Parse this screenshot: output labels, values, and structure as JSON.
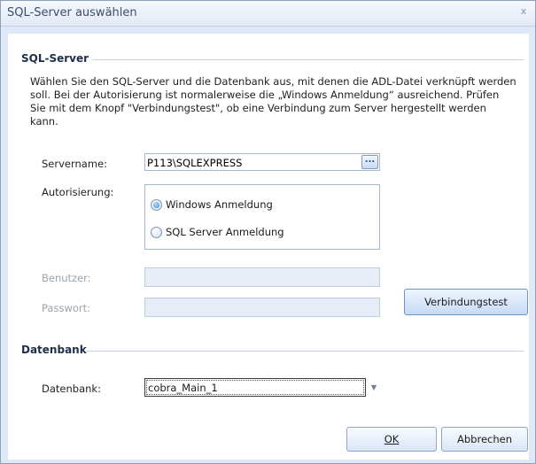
{
  "window": {
    "title": "SQL-Server auswählen",
    "close_glyph": "x"
  },
  "sql_section": {
    "title": "SQL-Server",
    "description": "Wählen Sie den SQL-Server und die Datenbank aus, mit denen die ADL-Datei verknüpft werden soll. Bei der Autorisierung ist normalerweise die „Windows Anmeldung“ ausreichend. Prüfen Sie mit dem Knopf \"Verbindungstest\", ob eine Verbindung zum Server hergestellt werden kann.",
    "servername_label": "Servername:",
    "servername_value": "P113\\SQLEXPRESS",
    "browse_label": "...",
    "auth_label": "Autorisierung:",
    "auth_options": [
      {
        "label": "Windows Anmeldung",
        "checked": true
      },
      {
        "label": "SQL Server Anmeldung",
        "checked": false
      }
    ],
    "user_label": "Benutzer:",
    "user_value": "",
    "password_label": "Passwort:",
    "password_value": "",
    "test_button": "Verbindungstest"
  },
  "db_section": {
    "title": "Datenbank",
    "db_label": "Datenbank:",
    "db_value": "cobra_Main_1",
    "dropdown_glyph": "▼"
  },
  "footer": {
    "ok_label": "OK",
    "cancel_label": "Abbrechen"
  },
  "colors": {
    "accent": "#2f86d6",
    "window_border": "#8aa0bd"
  }
}
